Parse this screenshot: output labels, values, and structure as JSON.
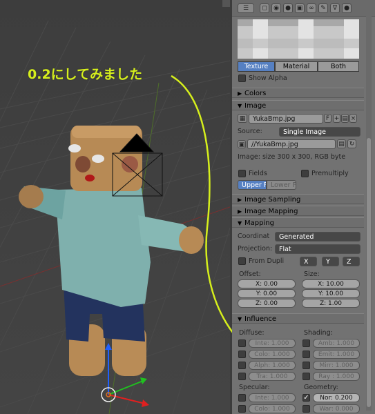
{
  "annotation": "0.2にしてみました",
  "preview": {
    "show_alpha": "Show Alpha",
    "tabs": [
      "Texture",
      "Material",
      "Both"
    ]
  },
  "sections": {
    "colors": "Colors",
    "image": "Image",
    "image_sampling": "Image Sampling",
    "image_mapping": "Image Mapping",
    "mapping": "Mapping",
    "influence": "Influence"
  },
  "image": {
    "name": "YukaBmp.jpg",
    "f_button": "F",
    "source_label": "Source:",
    "source_value": "Single Image",
    "path": "//YukaBmp.jpg",
    "info": "Image: size 300 x 300, RGB byte",
    "fields": "Fields",
    "premultiply": "Premultiply",
    "upper_first": "Upper Fi",
    "lower_first": "Lower Fir"
  },
  "mapping": {
    "coord_label": "Coordinat",
    "coord_value": "Generated",
    "projection_label": "Projection:",
    "projection_value": "Flat",
    "from_dupli": "From Dupli",
    "axis_x": "X",
    "axis_y": "Y",
    "axis_z": "Z",
    "offset_label": "Offset:",
    "size_label": "Size:",
    "offset": [
      "X: 0.00",
      "Y: 0.00",
      "Z: 0.00"
    ],
    "size": [
      "X: 10.00",
      "Y: 10.00",
      "Z: 1.00"
    ]
  },
  "influence": {
    "diffuse_label": "Diffuse:",
    "shading_label": "Shading:",
    "specular_label": "Specular:",
    "geometry_label": "Geometry:",
    "diffuse": [
      "Inte: 1.000",
      "Colo: 1.000",
      "Alph: 1.000",
      "Tra: 1.000"
    ],
    "shading": [
      "Amb: 1.000",
      "Emit: 1.000",
      "Mirr: 1.000",
      "Ray : 1.000"
    ],
    "specular": [
      "Inte: 1.000",
      "Colo: 1.000"
    ],
    "geometry": [
      "Nor: 0.200",
      "War: 0.000"
    ]
  },
  "colors": {
    "annotation": "#d6ef1c",
    "accent": "#5680c2",
    "viewport_bg": "#3b3b3b",
    "panel_bg": "#727272"
  },
  "icons": [
    "view-icon",
    "render-icon",
    "world-icon",
    "object-icon",
    "material-icon",
    "texture-icon",
    "particles-icon",
    "physics-icon"
  ]
}
